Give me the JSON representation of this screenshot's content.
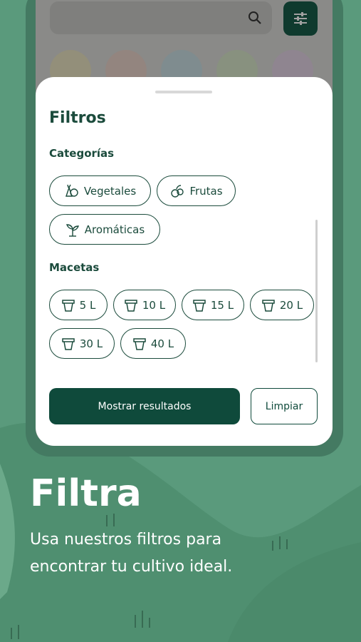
{
  "colors": {
    "background": "#5a9a7c",
    "primary": "#0f4a3b",
    "text_dark": "#1b4b3c",
    "sheet": "#ffffff"
  },
  "top_bar": {
    "search_icon": "search-icon",
    "filter_icon": "sliders-icon"
  },
  "sheet": {
    "title": "Filtros",
    "categories_heading": "Categorías",
    "categories": [
      {
        "label": "Vegetales",
        "icon": "vegetables-icon"
      },
      {
        "label": "Frutas",
        "icon": "fruits-icon"
      },
      {
        "label": "Aromáticas",
        "icon": "sprout-icon"
      }
    ],
    "pots_heading": "Macetas",
    "pots": [
      {
        "label": "5 L"
      },
      {
        "label": "10 L"
      },
      {
        "label": "15 L"
      },
      {
        "label": "20 L"
      },
      {
        "label": "30 L"
      },
      {
        "label": "40 L"
      }
    ],
    "show_results": "Mostrar resultados",
    "clear": "Limpiar"
  },
  "promo": {
    "headline": "Filtra",
    "subtitle": "Usa nuestros filtros para encontrar tu cultivo ideal."
  }
}
